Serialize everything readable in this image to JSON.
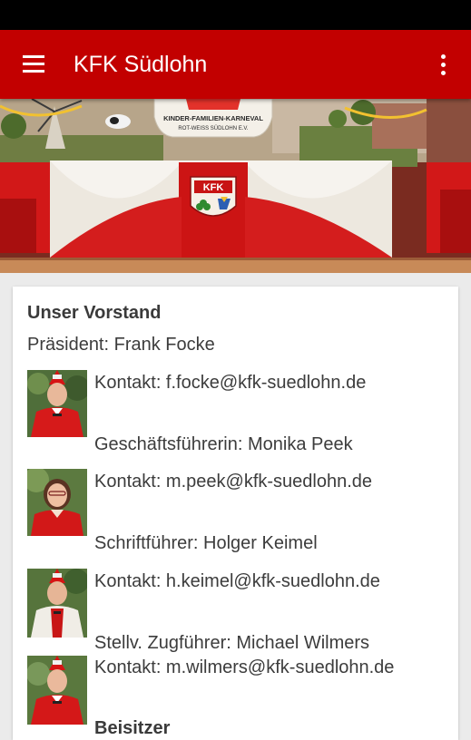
{
  "app": {
    "title": "KFK Südlohn",
    "colors": {
      "primary": "#c20000",
      "status_bar": "#000000",
      "background": "#ebebeb"
    },
    "icons": {
      "menu": "hamburger-menu-icon",
      "overflow": "more-vertical-icon"
    }
  },
  "hero": {
    "banner_text_line1": "KINDER-FAMILIEN-KARNEVAL",
    "banner_text_line2": "ROT-WEISS SÜDLOHN E.V.",
    "emblem_text": "KFK"
  },
  "board": {
    "title": "Unser Vorstand",
    "members": [
      {
        "role": "Präsident: Frank Focke",
        "contact": "Kontakt: f.focke@kfk-suedlohn.de"
      },
      {
        "role": "Geschäftsführerin: Monika Peek",
        "contact": "Kontakt: m.peek@kfk-suedlohn.de"
      },
      {
        "role": "Schriftführer: Holger Keimel",
        "contact": "Kontakt: h.keimel@kfk-suedlohn.de"
      },
      {
        "role": "Stellv. Zugführer: Michael Wilmers",
        "contact": "Kontakt: m.wilmers@kfk-suedlohn.de"
      }
    ],
    "next_heading": "Beisitzer"
  }
}
